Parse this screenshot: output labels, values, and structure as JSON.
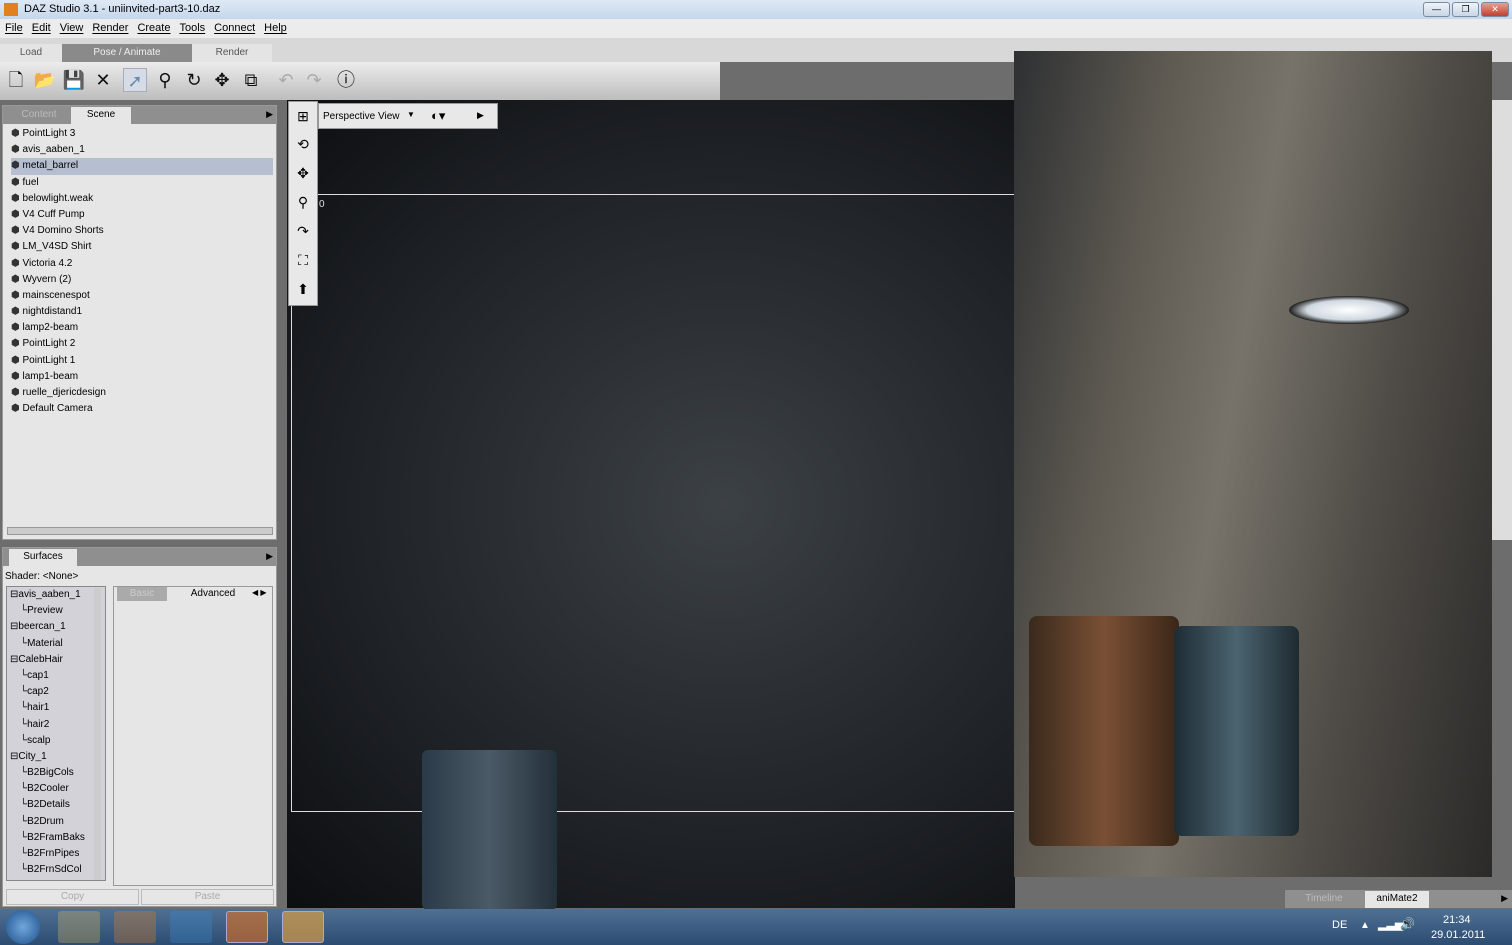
{
  "window": {
    "title": "DAZ Studio 3.1  - uniinvited-part3-10.daz",
    "min": "—",
    "max": "❐",
    "close": "✕"
  },
  "menu": [
    "File",
    "Edit",
    "View",
    "Render",
    "Create",
    "Tools",
    "Connect",
    "Help"
  ],
  "main_tabs": [
    "Load",
    "Pose / Animate",
    "Render"
  ],
  "scene_panel": {
    "tabs": [
      "Content",
      "Scene"
    ],
    "items": [
      "PointLight 3",
      "avis_aaben_1",
      "metal_barrel",
      "fuel",
      "belowlight.weak",
      "V4 Cuff Pump",
      "V4 Domino Shorts",
      "LM_V4SD Shirt",
      "Victoria 4.2",
      "Wyvern (2)",
      "mainscenespot",
      "nightdistand1",
      "lamp2-beam",
      "PointLight 2",
      "PointLight 1",
      "lamp1-beam",
      "ruelle_djericdesign",
      "Default Camera"
    ],
    "selected": "metal_barrel"
  },
  "surfaces_panel": {
    "tab": "Surfaces",
    "shader": "Shader: <None>",
    "subtabs": [
      "Basic",
      "Advanced"
    ],
    "tree": [
      {
        "t": "avis_aaben_1",
        "l": 0
      },
      {
        "t": "Preview",
        "l": 1
      },
      {
        "t": "beercan_1",
        "l": 0
      },
      {
        "t": "Material",
        "l": 1
      },
      {
        "t": "CalebHair",
        "l": 0
      },
      {
        "t": "cap1",
        "l": 1
      },
      {
        "t": "cap2",
        "l": 1
      },
      {
        "t": "hair1",
        "l": 1
      },
      {
        "t": "hair2",
        "l": 1
      },
      {
        "t": "scalp",
        "l": 1
      },
      {
        "t": "City_1",
        "l": 0
      },
      {
        "t": "B2BigCols",
        "l": 1
      },
      {
        "t": "B2Cooler",
        "l": 1
      },
      {
        "t": "B2Details",
        "l": 1
      },
      {
        "t": "B2Drum",
        "l": 1
      },
      {
        "t": "B2FramBaks",
        "l": 1
      },
      {
        "t": "B2FrnPipes",
        "l": 1
      },
      {
        "t": "B2FrnSdCol",
        "l": 1
      }
    ],
    "copy": "Copy",
    "paste": "Paste"
  },
  "viewport": {
    "view": "Perspective View",
    "frame_label": "0"
  },
  "bottom_tabs": [
    "Timeline",
    "aniMate2"
  ],
  "taskbar": {
    "lang": "DE",
    "time": "21:34",
    "date": "29.01.2011"
  }
}
